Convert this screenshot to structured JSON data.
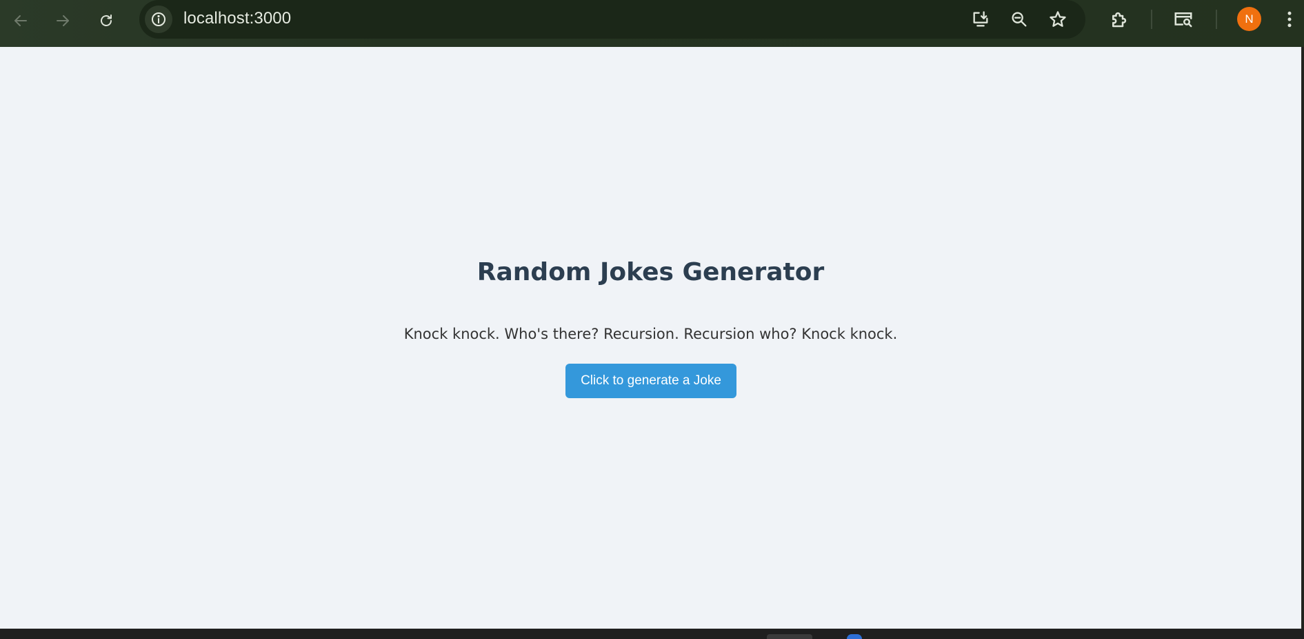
{
  "browser": {
    "url": "localhost:3000",
    "profile_initial": "N",
    "colors": {
      "toolbar": "#253322",
      "omnibox": "#1b2718",
      "avatar": "#f0700f"
    },
    "icons": {
      "back": "arrow-left",
      "forward": "arrow-right",
      "reload": "reload",
      "site_info": "info-circle",
      "install": "install-app",
      "zoom": "magnifier-minus",
      "bookmark": "star",
      "extensions": "puzzle-piece",
      "reading_mode": "screen-search",
      "menu": "three-dots-vertical"
    }
  },
  "page": {
    "title": "Random Jokes Generator",
    "joke": "Knock knock. Who's there? Recursion. Recursion who? Knock knock.",
    "button_label": "Click to generate a Joke",
    "colors": {
      "background": "#f0f3f7",
      "title": "#2c3e50",
      "button": "#3498db"
    }
  }
}
